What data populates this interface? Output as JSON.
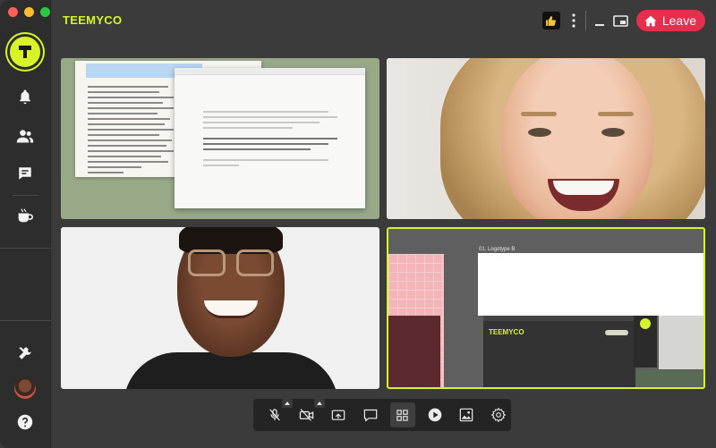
{
  "app": {
    "brand": "TEEMYCO",
    "accent": "#d9f32a",
    "leave_color": "#e62e4d"
  },
  "window_controls": [
    "close",
    "minimize",
    "zoom"
  ],
  "sidebar": {
    "items": [
      {
        "name": "notifications",
        "icon": "bell-icon"
      },
      {
        "name": "people",
        "icon": "people-icon"
      },
      {
        "name": "chat",
        "icon": "chat-bubble-icon"
      },
      {
        "name": "break",
        "icon": "coffee-cup-icon"
      },
      {
        "name": "tools",
        "icon": "tools-icon"
      },
      {
        "name": "profile",
        "icon": "avatar"
      },
      {
        "name": "help",
        "icon": "help-icon"
      }
    ]
  },
  "header": {
    "reaction_icon": "thumbs-up-icon",
    "more_icon": "kebab-menu-icon",
    "minimize_icon": "minimize-icon",
    "pip_icon": "picture-in-picture-icon",
    "leave_label": "Leave"
  },
  "tiles": {
    "screen_share_left": {
      "highlighted_text": "A cozy-friendly online office that feels like home where your hybrid or distributed team can collaborate, hang out and deliver the best work of your career.",
      "editor_text": "Effortlessly connect and come together virtually with the distributed, no matter how far the distance. Digital availability, gather for daily video meetings, host workshops, webinars and events and more — transparent and inclusive!",
      "editor_highlight": "A cozy-friendly online office that feels like home where your hybrid or distributed team can collaborate, hang out and deliver the best work of your career.",
      "editor_tail": "Talent knows no borders. Get team feel close together, get up all over."
    },
    "design_share": {
      "section_title": "01. Logotype B",
      "mock_brand": "TEEMYCO"
    }
  },
  "toolbar": {
    "buttons": [
      {
        "name": "mic-muted",
        "icon": "mic-off-icon",
        "has_caret": true
      },
      {
        "name": "camera-off",
        "icon": "camera-off-icon",
        "has_caret": true
      },
      {
        "name": "share-screen",
        "icon": "screen-share-icon",
        "has_caret": false
      },
      {
        "name": "whiteboard",
        "icon": "present-icon",
        "has_caret": false
      },
      {
        "name": "grid-view",
        "icon": "grid-icon",
        "has_caret": false,
        "active": true
      },
      {
        "name": "play",
        "icon": "play-circle-icon",
        "has_caret": false
      },
      {
        "name": "background",
        "icon": "image-icon",
        "has_caret": false
      },
      {
        "name": "settings",
        "icon": "gear-icon",
        "has_caret": false
      }
    ]
  }
}
